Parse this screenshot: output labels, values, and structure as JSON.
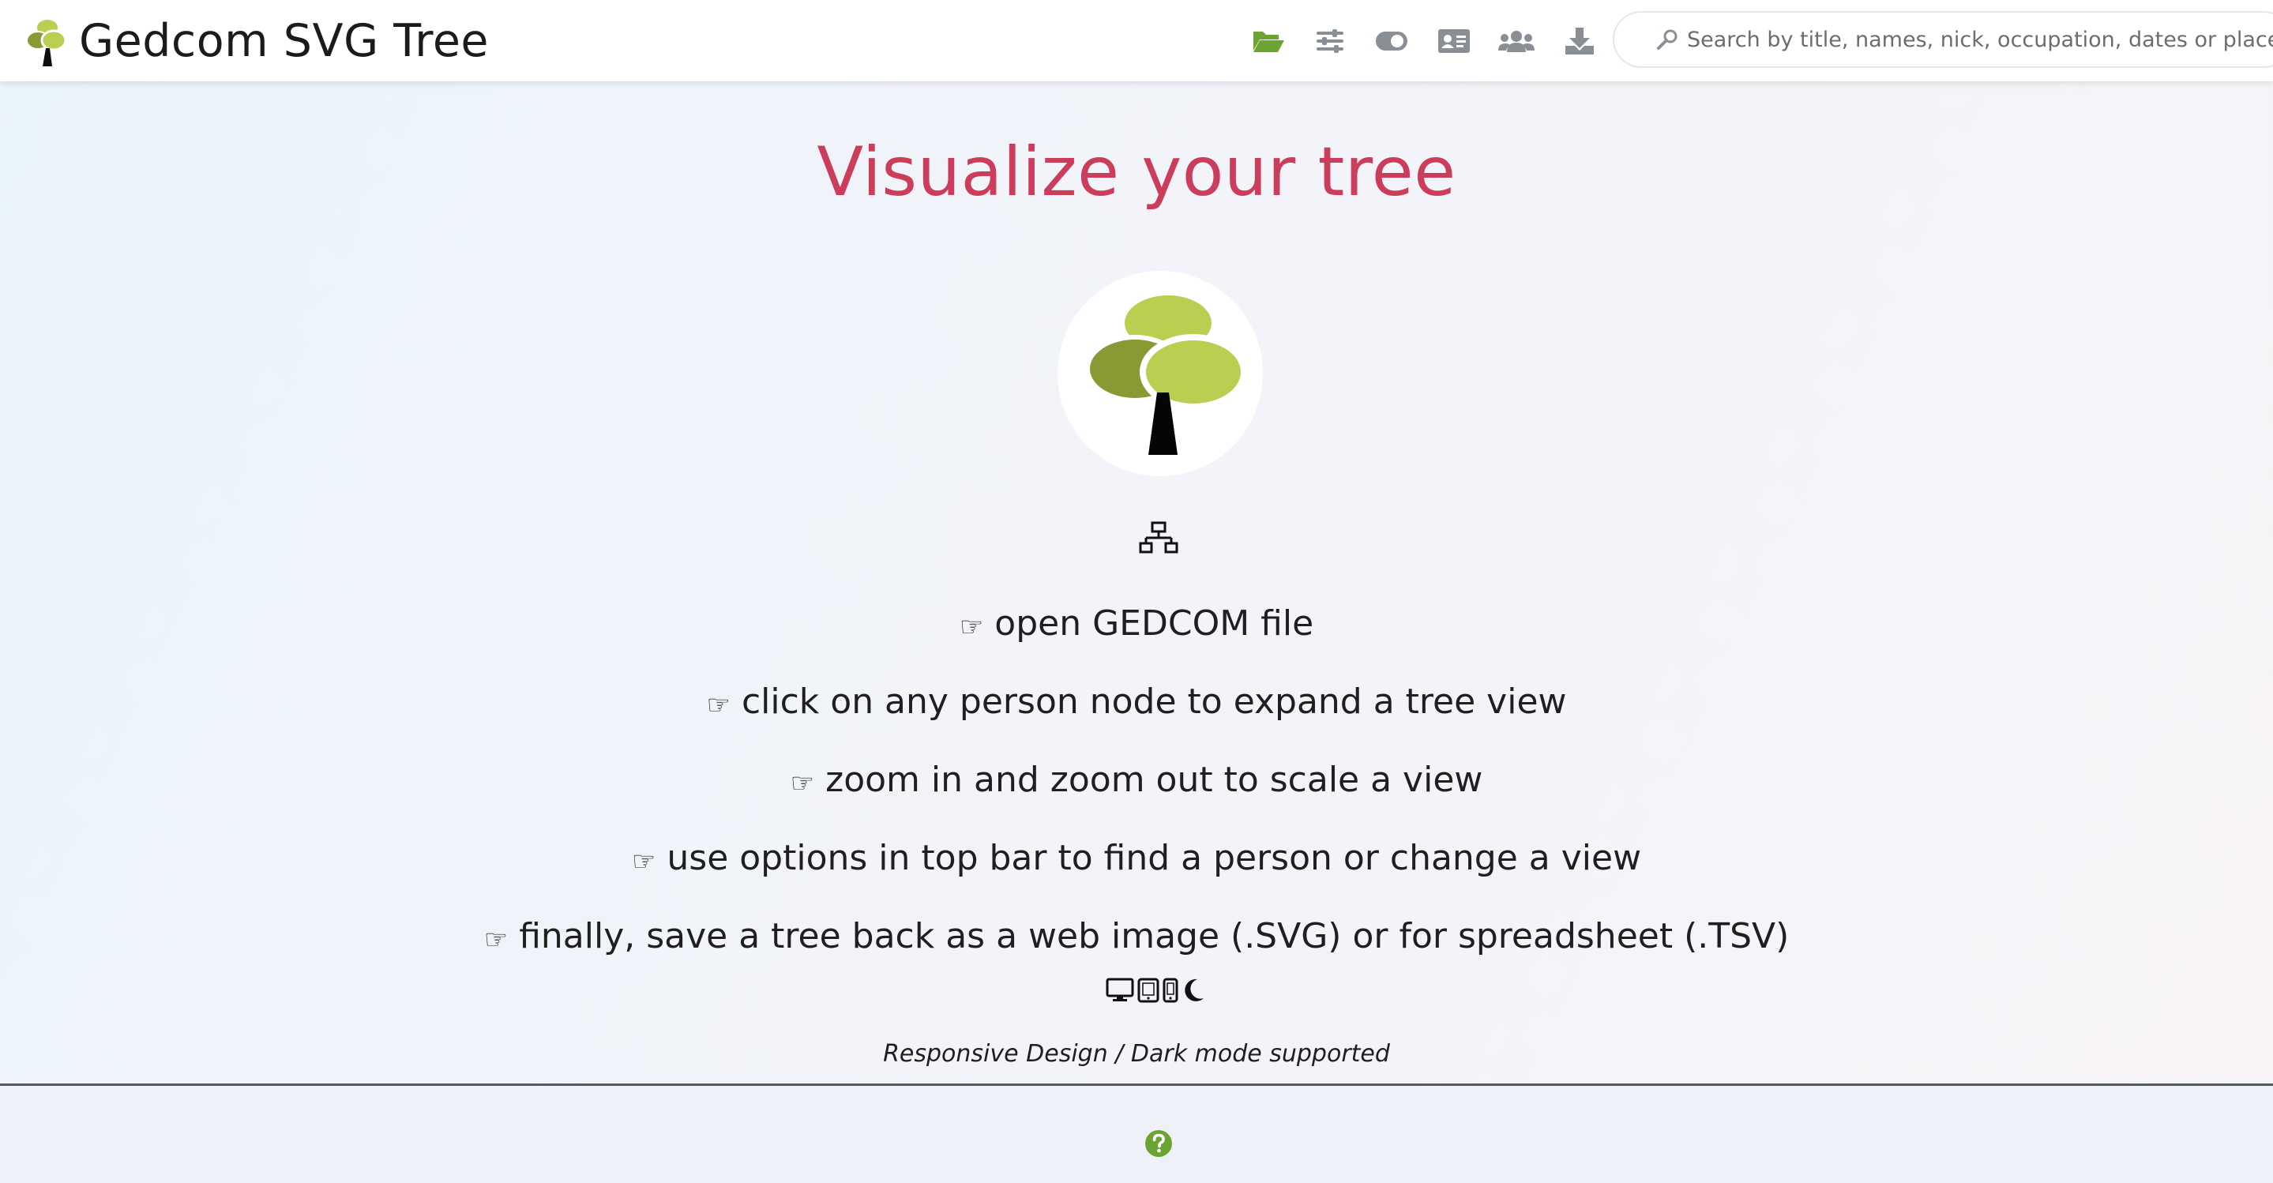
{
  "header": {
    "app_title": "Gedcom SVG Tree",
    "toolbar": [
      {
        "name": "open-file-button",
        "icon": "folder-open-icon",
        "color": "#6aa531"
      },
      {
        "name": "options-button",
        "icon": "sliders-icon",
        "color": "#8a8f96"
      },
      {
        "name": "view-toggle-button",
        "icon": "toggle-icon",
        "color": "#8a8f96"
      },
      {
        "name": "person-card-button",
        "icon": "id-card-icon",
        "color": "#8a8f96"
      },
      {
        "name": "people-button",
        "icon": "users-icon",
        "color": "#8a8f96"
      },
      {
        "name": "download-button",
        "icon": "download-icon",
        "color": "#8a8f96"
      }
    ],
    "search": {
      "placeholder": "Search by title, names, nick, occupation, dates or places..."
    }
  },
  "main": {
    "title": "Visualize your tree",
    "steps": [
      {
        "hand": "☞",
        "text": "open GEDCOM file"
      },
      {
        "hand": "☞",
        "text": "click on any person node to expand a tree view"
      },
      {
        "hand": "☞",
        "text": "zoom in and zoom out to scale a view"
      },
      {
        "hand": "☞",
        "text": "use options in top bar to find a person or change a view"
      },
      {
        "hand": "☞",
        "text": "finally, save a tree back as a web image (.SVG) or for spreadsheet (.TSV)"
      }
    ],
    "device_icons": [
      "desktop-icon",
      "tablet-icon",
      "mobile-icon",
      "moon-icon"
    ],
    "note": "Responsive Design / Dark mode supported"
  },
  "footer": {
    "help_icon": "question-circle-icon"
  },
  "colors": {
    "accent_title": "#cc3d5c",
    "brand_green": "#6aa531",
    "leaf_light": "#b8cf52",
    "leaf_dark": "#889a34"
  }
}
